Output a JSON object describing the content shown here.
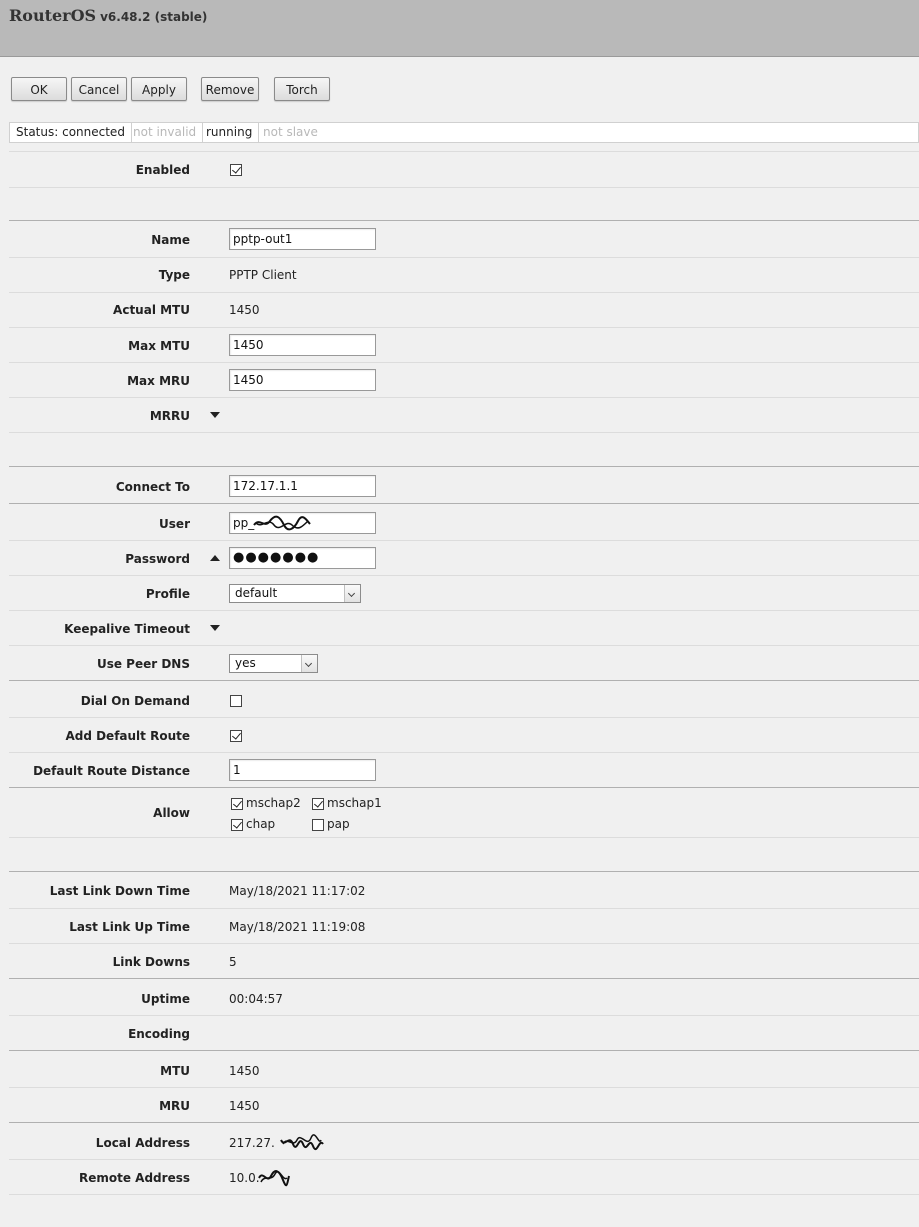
{
  "header": {
    "brand": "RouterOS",
    "version": "v6.48.2 (stable)"
  },
  "toolbar": {
    "ok": "OK",
    "cancel": "Cancel",
    "apply": "Apply",
    "remove": "Remove",
    "torch": "Torch"
  },
  "status": {
    "connected": "Status: connected",
    "invalid": "not invalid",
    "running": "running",
    "slave": "not slave"
  },
  "fields": {
    "enabled": {
      "label": "Enabled",
      "checked": true
    },
    "name": {
      "label": "Name",
      "value": "pptp-out1"
    },
    "type": {
      "label": "Type",
      "value": "PPTP Client"
    },
    "actual_mtu": {
      "label": "Actual MTU",
      "value": "1450"
    },
    "max_mtu": {
      "label": "Max MTU",
      "value": "1450"
    },
    "max_mru": {
      "label": "Max MRU",
      "value": "1450"
    },
    "mrru": {
      "label": "MRRU"
    },
    "connect_to": {
      "label": "Connect To",
      "value": "172.17.1.1"
    },
    "user": {
      "label": "User",
      "value": "pp_"
    },
    "password": {
      "label": "Password",
      "value": "●●●●●●●"
    },
    "profile": {
      "label": "Profile",
      "value": "default"
    },
    "keepalive": {
      "label": "Keepalive Timeout"
    },
    "use_peer_dns": {
      "label": "Use Peer DNS",
      "value": "yes"
    },
    "dial_on_demand": {
      "label": "Dial On Demand",
      "checked": false
    },
    "add_default_route": {
      "label": "Add Default Route",
      "checked": true
    },
    "default_route_distance": {
      "label": "Default Route Distance",
      "value": "1"
    },
    "allow": {
      "label": "Allow",
      "options": [
        {
          "name": "mschap2",
          "checked": true
        },
        {
          "name": "mschap1",
          "checked": true
        },
        {
          "name": "chap",
          "checked": true
        },
        {
          "name": "pap",
          "checked": false
        }
      ]
    },
    "last_link_down": {
      "label": "Last Link Down Time",
      "value": "May/18/2021 11:17:02"
    },
    "last_link_up": {
      "label": "Last Link Up Time",
      "value": "May/18/2021 11:19:08"
    },
    "link_downs": {
      "label": "Link Downs",
      "value": "5"
    },
    "uptime": {
      "label": "Uptime",
      "value": "00:04:57"
    },
    "encoding": {
      "label": "Encoding",
      "value": ""
    },
    "mtu": {
      "label": "MTU",
      "value": "1450"
    },
    "mru": {
      "label": "MRU",
      "value": "1450"
    },
    "local_address": {
      "label": "Local Address",
      "value": "217.27."
    },
    "remote_address": {
      "label": "Remote Address",
      "value": "10.0."
    }
  }
}
